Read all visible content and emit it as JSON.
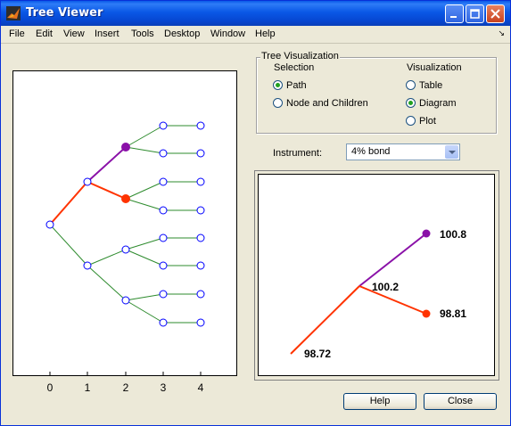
{
  "window": {
    "title": "Tree Viewer"
  },
  "menu": {
    "items": [
      "File",
      "Edit",
      "View",
      "Insert",
      "Tools",
      "Desktop",
      "Window",
      "Help"
    ]
  },
  "tree_axis": {
    "x_ticks": [
      "0",
      "1",
      "2",
      "3",
      "4"
    ]
  },
  "tree_visualization": {
    "title": "Tree Visualization",
    "selection_label": "Selection",
    "selection_options": [
      "Path",
      "Node and Children"
    ],
    "selection_value": "Path",
    "visualization_label": "Visualization",
    "visualization_options": [
      "Table",
      "Diagram",
      "Plot"
    ],
    "visualization_value": "Diagram"
  },
  "instrument": {
    "label": "Instrument:",
    "value": "4% bond"
  },
  "diagram": {
    "values": {
      "root": "98.72",
      "middle": "100.2",
      "up": "100.8",
      "down": "98.81"
    },
    "colors": {
      "path": "#ff3300",
      "up": "#8a11a8",
      "down": "#ff3300",
      "tree_lines": "#2e8b2e",
      "tree_nodes": "#0000ff"
    }
  },
  "buttons": {
    "help": "Help",
    "close": "Close"
  }
}
